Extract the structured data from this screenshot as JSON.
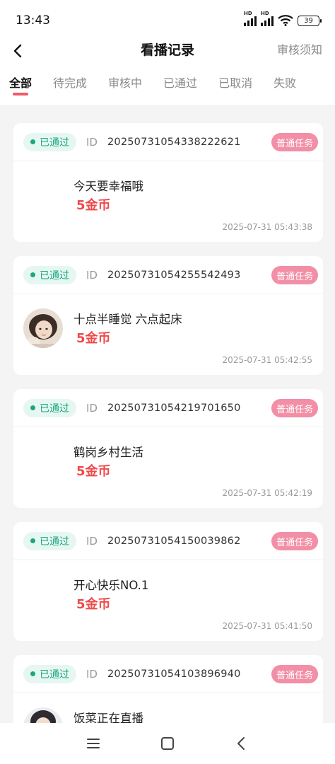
{
  "status_bar": {
    "time": "13:43",
    "signal1_label": "HD",
    "signal2_label": "HD",
    "battery": "39"
  },
  "header": {
    "title": "看播记录",
    "rule_link": "审核须知"
  },
  "tabs": [
    {
      "label": "全部",
      "active": true
    },
    {
      "label": "待完成",
      "active": false
    },
    {
      "label": "审核中",
      "active": false
    },
    {
      "label": "已通过",
      "active": false
    },
    {
      "label": "已取消",
      "active": false
    },
    {
      "label": "失败",
      "active": false
    }
  ],
  "records": [
    {
      "status": "已通过",
      "id_label": "ID",
      "id": "20250731054338222621",
      "tag": "普通任务",
      "name": "今天要幸福哦",
      "reward": "5金币",
      "time": "2025-07-31 05:43:38",
      "has_avatar": false
    },
    {
      "status": "已通过",
      "id_label": "ID",
      "id": "20250731054255542493",
      "tag": "普通任务",
      "name": "十点半睡觉 六点起床",
      "reward": "5金币",
      "time": "2025-07-31 05:42:55",
      "has_avatar": true
    },
    {
      "status": "已通过",
      "id_label": "ID",
      "id": "20250731054219701650",
      "tag": "普通任务",
      "name": "鹤岗乡村生活",
      "reward": "5金币",
      "time": "2025-07-31 05:42:19",
      "has_avatar": false
    },
    {
      "status": "已通过",
      "id_label": "ID",
      "id": "20250731054150039862",
      "tag": "普通任务",
      "name": "开心快乐NO.1",
      "reward": "5金币",
      "time": "2025-07-31 05:41:50",
      "has_avatar": false
    },
    {
      "status": "已通过",
      "id_label": "ID",
      "id": "20250731054103896940",
      "tag": "普通任务",
      "name": "饭菜正在直播",
      "reward": "",
      "time": "",
      "has_avatar": true
    }
  ],
  "colors": {
    "accent": "#ef5a6a",
    "status_green": "#1aa77f",
    "tag_pink": "#f28fa6",
    "reward_red": "#ef4a4a"
  },
  "icons": {
    "back": "chevron-left-icon",
    "menu": "menu-icon",
    "home": "square-home-icon",
    "back_key": "triangle-back-icon"
  }
}
